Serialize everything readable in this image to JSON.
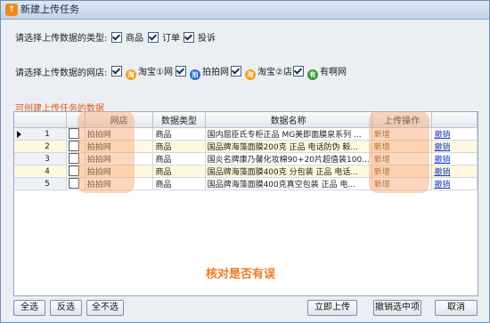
{
  "window": {
    "title": "新建上传任务",
    "app_icon": "upload-app-icon"
  },
  "type_row": {
    "label": "请选择上传数据的类型:",
    "options": [
      {
        "label": "商品",
        "checked": true
      },
      {
        "label": "订单",
        "checked": true
      },
      {
        "label": "投诉",
        "checked": true
      }
    ]
  },
  "store_row": {
    "label": "请选择上传数据的网店:",
    "options": [
      {
        "label": "淘宝①网",
        "checked": true,
        "icon": "taobao-icon",
        "color": "#f5a21a"
      },
      {
        "label": "拍拍网",
        "checked": true,
        "icon": "paipai-icon",
        "color": "#2a6fd6"
      },
      {
        "label": "淘宝②店",
        "checked": true,
        "icon": "taobao-icon",
        "color": "#f5a21a"
      },
      {
        "label": "有啊网",
        "checked": true,
        "icon": "youa-icon",
        "color": "#3a9a3a"
      }
    ]
  },
  "section_title": "可创建上传任务的数据",
  "grid": {
    "columns": [
      "网店",
      "数据类型",
      "数据名称",
      "上传操作"
    ],
    "rows": [
      {
        "num": "1",
        "store": "拍拍网",
        "type": "商品",
        "name": "国内屈臣氏专柜正品 MG美即面膜泉系列 ...",
        "action": "新增",
        "link": "撤销",
        "current": true
      },
      {
        "num": "2",
        "store": "拍拍网",
        "type": "商品",
        "name": "国品牌海藻面膜200克 正品 电话防伪 毅...",
        "action": "新增",
        "link": "撤销"
      },
      {
        "num": "3",
        "store": "拍拍网",
        "type": "商品",
        "name": "国炎名牌康乃馨化妆棉90+20片超值装100...",
        "action": "新增",
        "link": "撤销"
      },
      {
        "num": "4",
        "store": "拍拍网",
        "type": "商品",
        "name": "国品牌海藻面膜400克 分包装 正品 电话...",
        "action": "新增",
        "link": "撤销"
      },
      {
        "num": "5",
        "store": "拍拍网",
        "type": "商品",
        "name": "国品牌海藻面膜400克真空包装 正品 电...",
        "action": "新增",
        "link": "撤销"
      }
    ]
  },
  "annotation": "核对是否有误",
  "buttons": {
    "select_all": "全选",
    "invert": "反选",
    "select_none": "全不选",
    "upload_now": "立即上传",
    "cancel_selected": "撤销选中项",
    "cancel": "取消"
  },
  "colors": {
    "highlight": "#f9a56e",
    "annotation": "#f07a1c",
    "section_title": "#e05a14"
  }
}
